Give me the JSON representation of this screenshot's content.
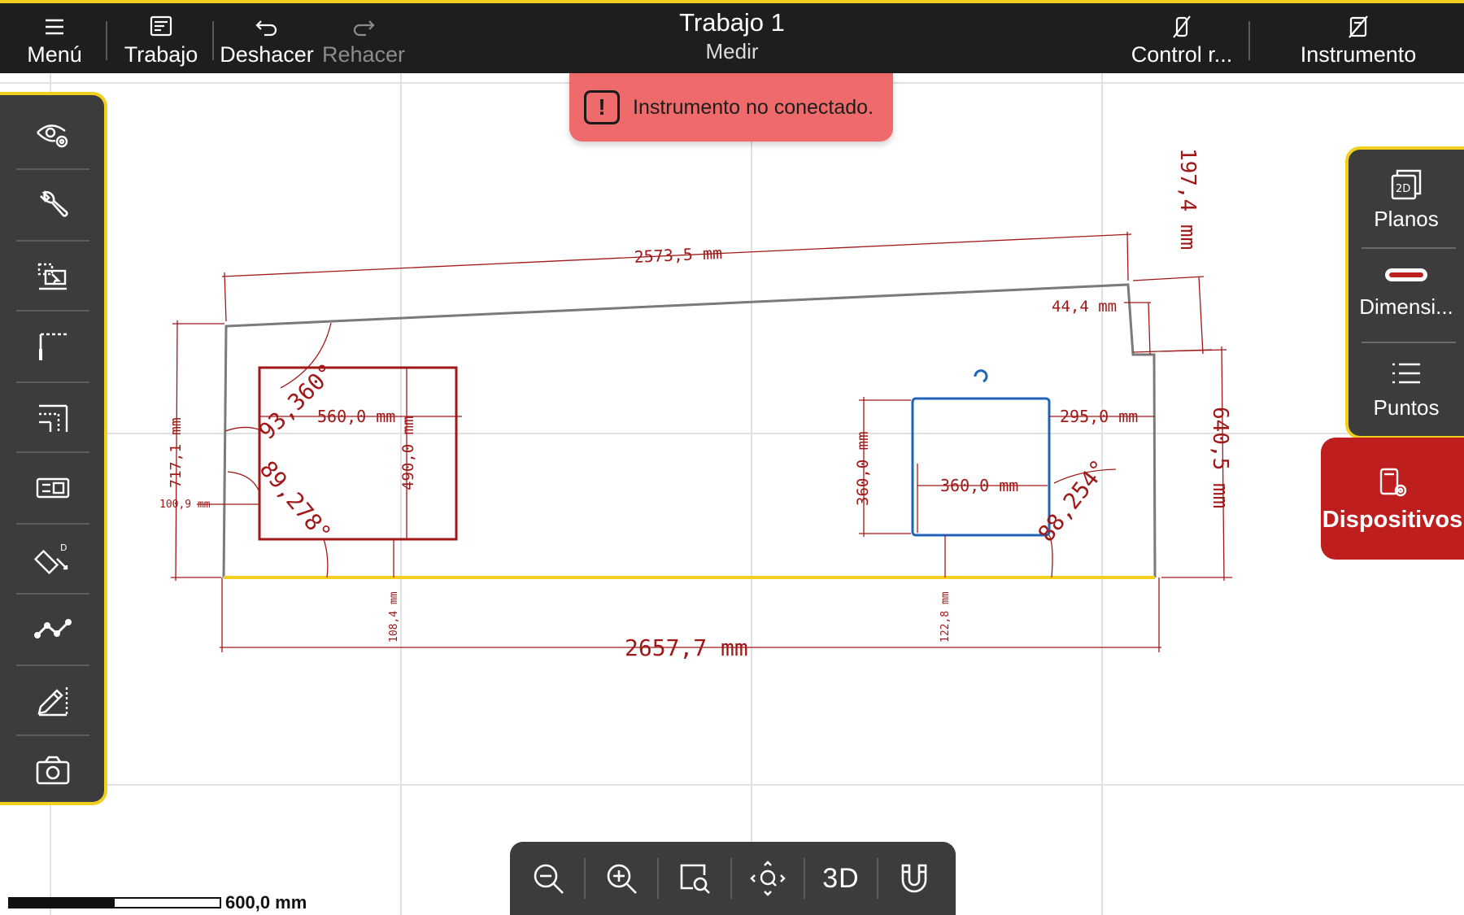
{
  "topbar": {
    "menu_label": "Menú",
    "job_label": "Trabajo",
    "undo_label": "Deshacer",
    "redo_label": "Rehacer",
    "title": "Trabajo 1",
    "subtitle": "Medir",
    "remote_label": "Control r...",
    "instrument_label": "Instrumento"
  },
  "toast": {
    "message": "Instrumento no conectado.",
    "icon": "alert-icon"
  },
  "left_toolbar": {
    "items": [
      "visibility-settings-icon",
      "wrench-icon",
      "layers-select-icon",
      "corner-line-icon",
      "parallel-offset-icon",
      "label-edit-icon",
      "measure-distance-icon",
      "polyline-icon",
      "sketch-pencil-icon",
      "camera-icon"
    ]
  },
  "right_panel": {
    "plans_label": "Planos",
    "plans_badge": "2D",
    "dimensions_label": "Dimensi...",
    "points_label": "Puntos",
    "devices_label": "Dispositivos"
  },
  "bottom_toolbar": {
    "items": [
      "zoom-out-icon",
      "zoom-in-icon",
      "zoom-window-icon",
      "zoom-fit-icon",
      "3d-view-icon",
      "snap-magnet-icon"
    ],
    "view3d_label": "3D"
  },
  "scale": {
    "label": "600,0 mm"
  },
  "drawing": {
    "dims": {
      "top": "2573,5 mm",
      "notch_height": "197,4 mm",
      "notch_width": "44,4 mm",
      "left_height": "717,1 mm",
      "left_offset": "100,9 mm",
      "angle_top_left": "93,360°",
      "angle_bottom_left": "89,278°",
      "rect1_width": "560,0 mm",
      "rect1_height": "490,0 mm",
      "rect1_bottom": "108,4 mm",
      "rect2_height": "360,0 mm",
      "rect2_width": "360,0 mm",
      "rect2_right": "295,0 mm",
      "rect2_bottom": "122,8 mm",
      "angle_bottom_right": "88,254°",
      "right_height": "640,5 mm",
      "bottom": "2657,7 mm"
    },
    "colors": {
      "dimension": "#a01818",
      "outline": "#7a7a7a",
      "base_edge": "#f2cf1d",
      "selected": "#1d64b8",
      "grid": "#e1e1e1"
    }
  }
}
